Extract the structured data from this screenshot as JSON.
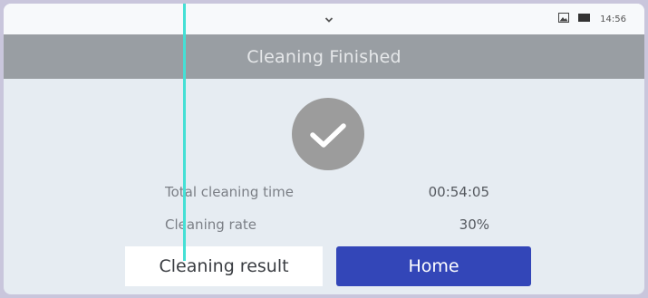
{
  "status_bar": {
    "time": "14:56",
    "icons": [
      "chevron-down-icon",
      "image-icon",
      "battery-icon"
    ]
  },
  "header": {
    "title": "Cleaning Finished"
  },
  "result_icon": "check-circle-icon",
  "details": [
    {
      "label": "Total cleaning time",
      "value": "00:54:05"
    },
    {
      "label": "Cleaning rate",
      "value": "30%"
    }
  ],
  "buttons": {
    "result_label": "Cleaning result",
    "home_label": "Home"
  },
  "colors": {
    "header_bg": "#999ea3",
    "home_button_bg": "#3346b8",
    "cursor_line": "#45e0d5"
  }
}
